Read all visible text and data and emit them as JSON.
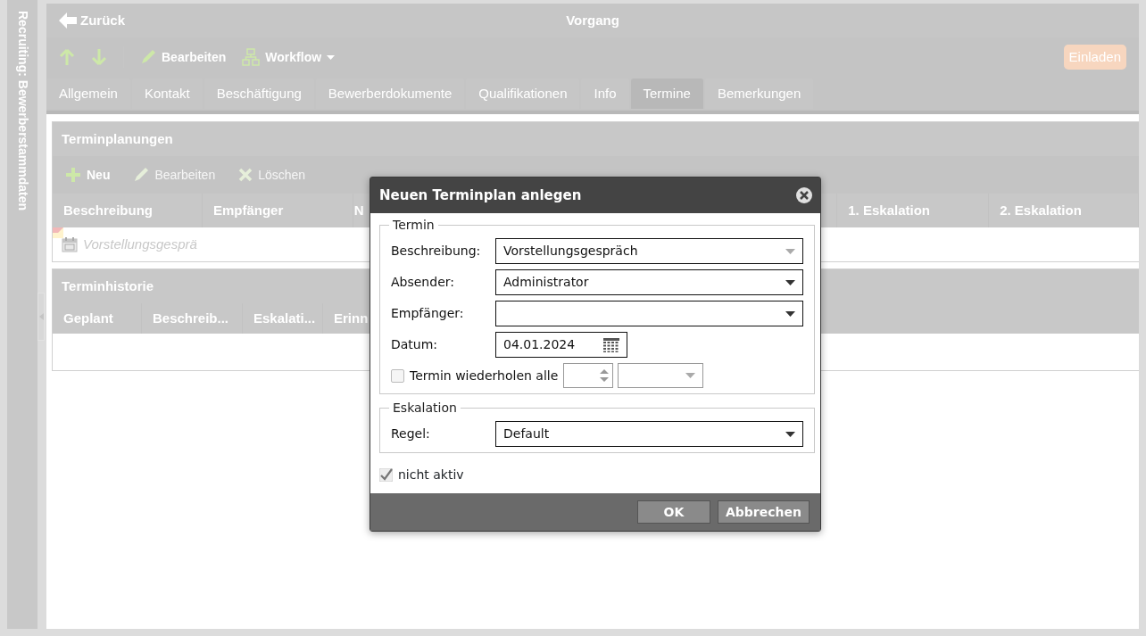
{
  "sidebar": {
    "title": "Recruiting: Bewerberstammdaten"
  },
  "header": {
    "back": "Zurück",
    "title": "Vorgang"
  },
  "toolbar": {
    "actions": [
      {
        "kind": "up"
      },
      {
        "kind": "down"
      },
      {
        "kind": "edit",
        "label": "Bearbeiten"
      },
      {
        "kind": "workflow",
        "label": "Workflow"
      }
    ],
    "invite": "Einladen"
  },
  "tabs": [
    {
      "label": "Allgemein",
      "selected": false
    },
    {
      "label": "Kontakt",
      "selected": false
    },
    {
      "label": "Beschäftigung",
      "selected": false
    },
    {
      "label": "Bewerberdokumente",
      "selected": false
    },
    {
      "label": "Qualifikationen",
      "selected": false
    },
    {
      "label": "Info",
      "selected": false
    },
    {
      "label": "Termine",
      "selected": true
    },
    {
      "label": "Bemerkungen",
      "selected": false
    }
  ],
  "planning": {
    "title": "Terminplanungen",
    "actions": [
      {
        "kind": "add",
        "label": "Neu",
        "disabled": false
      },
      {
        "kind": "edit",
        "label": "Bearbeiten",
        "disabled": true
      },
      {
        "kind": "delete",
        "label": "Löschen",
        "disabled": true
      }
    ],
    "columns": [
      "Beschreibung",
      "Empfänger",
      "N",
      "1. Eskalation",
      "2. Eskalation"
    ],
    "rows": [
      {
        "beschreibung": "Vorstellungsgesprä"
      }
    ]
  },
  "history": {
    "title": "Terminhistorie",
    "columns": [
      "Geplant",
      "Beschreib...",
      "Eskalati...",
      "Erinn"
    ]
  },
  "dialog": {
    "title": "Neuen Terminplan anlegen",
    "sections": [
      {
        "legend": "Termin",
        "fields": [
          {
            "kind": "combo",
            "label": "Beschreibung:",
            "value": "Vorstellungsgespräch"
          },
          {
            "kind": "select",
            "label": "Absender:",
            "value": "Administrator"
          },
          {
            "kind": "select",
            "label": "Empfänger:"
          },
          {
            "kind": "date",
            "label": "Datum:",
            "value": "04.01.2024"
          },
          {
            "kind": "repeat",
            "label": "Termin wiederholen alle",
            "checked": false
          }
        ]
      },
      {
        "legend": "Eskalation",
        "fields": [
          {
            "kind": "select",
            "label": "Regel:",
            "value": "Default"
          }
        ]
      }
    ],
    "inactive": {
      "label": "nicht aktiv",
      "checked": true
    },
    "buttons": [
      "OK",
      "Abbrechen"
    ]
  }
}
